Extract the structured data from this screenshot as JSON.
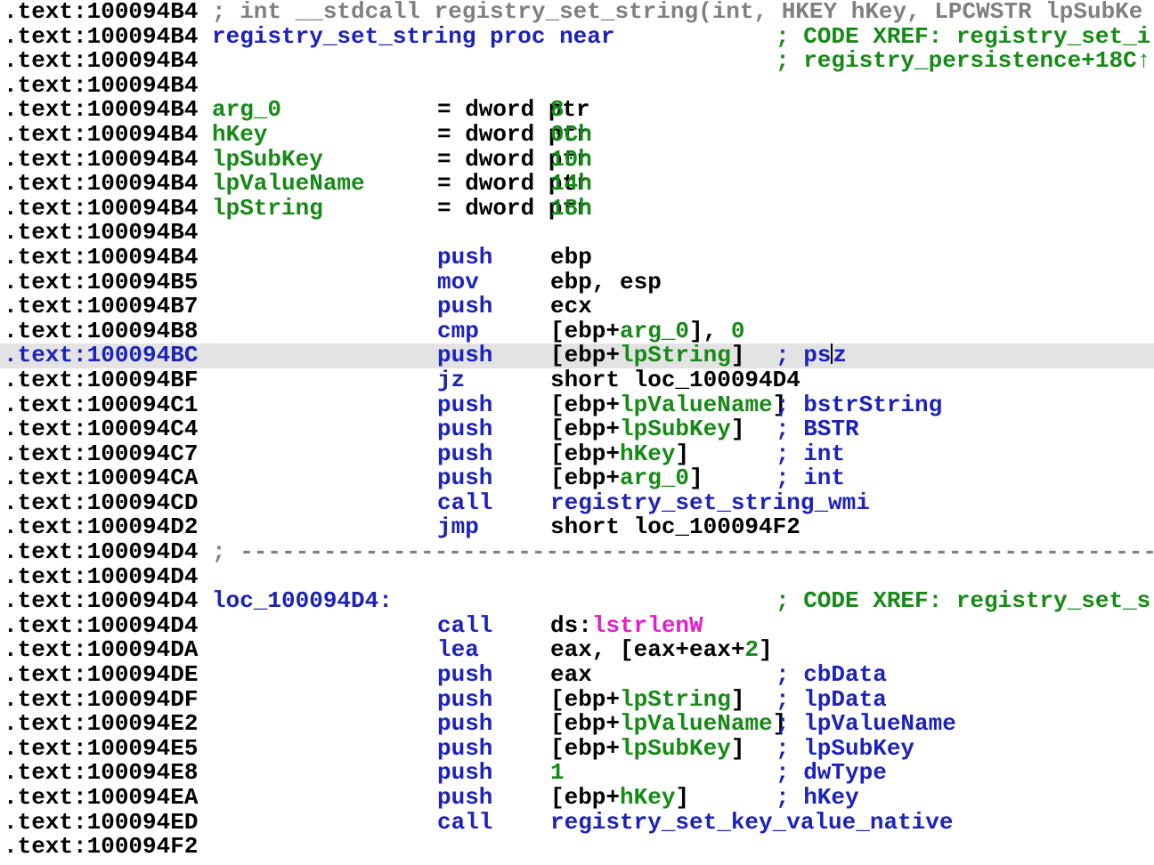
{
  "colors": {
    "address": "#000000",
    "selected_address": "#1d22b8",
    "mnemonic": "#1d22b8",
    "symbol": "#1d22b8",
    "variable": "#168a16",
    "xref_comment": "#168a16",
    "operand_comment": "#1d22b8",
    "import_name": "#e21ecf",
    "prototype_comment": "#808080",
    "selected_line_background": "#e3e3e3",
    "background": "#ffffff"
  },
  "lines": [
    {
      "addr": ".text:100094B4",
      "header": "; int __stdcall registry_set_string(int, HKEY hKey, LPCWSTR lpSubKe"
    },
    {
      "addr": ".text:100094B4",
      "label": "registry_set_string proc near",
      "comment": "; CODE XREF: registry_set_i"
    },
    {
      "addr": ".text:100094B4",
      "comment": "; registry_persistence+18C↑"
    },
    {
      "addr": ".text:100094B4"
    },
    {
      "addr": ".text:100094B4",
      "var": "arg_0",
      "eq": "= dword ptr",
      "val": "8"
    },
    {
      "addr": ".text:100094B4",
      "var": "hKey",
      "eq": "= dword ptr",
      "val": "0Ch"
    },
    {
      "addr": ".text:100094B4",
      "var": "lpSubKey",
      "eq": "= dword ptr",
      "val": "10h"
    },
    {
      "addr": ".text:100094B4",
      "var": "lpValueName",
      "eq": "= dword ptr",
      "val": "14h"
    },
    {
      "addr": ".text:100094B4",
      "var": "lpString",
      "eq": "= dword ptr",
      "val": "18h"
    },
    {
      "addr": ".text:100094B4"
    },
    {
      "addr": ".text:100094B4",
      "mn": "push",
      "op": [
        "ebp"
      ]
    },
    {
      "addr": ".text:100094B5",
      "mn": "mov",
      "op": [
        "ebp, esp"
      ]
    },
    {
      "addr": ".text:100094B7",
      "mn": "push",
      "op": [
        "ecx"
      ]
    },
    {
      "addr": ".text:100094B8",
      "mn": "cmp",
      "op": [
        "[ebp+",
        {
          "g": "arg_0"
        },
        "], ",
        {
          "g": "0"
        }
      ]
    },
    {
      "addr": ".text:100094BC",
      "mn": "push",
      "op": [
        "[ebp+",
        {
          "g": "lpString"
        },
        "]"
      ],
      "comment": "; ps",
      "comment_after_cursor": "z",
      "selected": true
    },
    {
      "addr": ".text:100094BF",
      "mn": "jz",
      "op": [
        "short loc_100094D4"
      ]
    },
    {
      "addr": ".text:100094C1",
      "mn": "push",
      "op": [
        "[ebp+",
        {
          "g": "lpValueName"
        },
        "]"
      ],
      "comment": "; bstrString"
    },
    {
      "addr": ".text:100094C4",
      "mn": "push",
      "op": [
        "[ebp+",
        {
          "g": "lpSubKey"
        },
        "]"
      ],
      "comment": "; BSTR"
    },
    {
      "addr": ".text:100094C7",
      "mn": "push",
      "op": [
        "[ebp+",
        {
          "g": "hKey"
        },
        "]"
      ],
      "comment": "; int"
    },
    {
      "addr": ".text:100094CA",
      "mn": "push",
      "op": [
        "[ebp+",
        {
          "g": "arg_0"
        },
        "]"
      ],
      "comment": "; int"
    },
    {
      "addr": ".text:100094CD",
      "mn": "call",
      "op": [
        {
          "b": "registry_set_string_wmi"
        }
      ]
    },
    {
      "addr": ".text:100094D2",
      "mn": "jmp",
      "op": [
        "short loc_100094F2"
      ]
    },
    {
      "addr": ".text:100094D4",
      "separator": "; -----------------------------------------------------------------------------------------------------"
    },
    {
      "addr": ".text:100094D4"
    },
    {
      "addr": ".text:100094D4",
      "label": "loc_100094D4:",
      "comment": "; CODE XREF: registry_set_s"
    },
    {
      "addr": ".text:100094D4",
      "mn": "call",
      "op": [
        "ds:",
        {
          "p": "lstrlenW"
        }
      ]
    },
    {
      "addr": ".text:100094DA",
      "mn": "lea",
      "op": [
        "eax, [eax+eax+",
        {
          "g": "2"
        },
        "]"
      ]
    },
    {
      "addr": ".text:100094DE",
      "mn": "push",
      "op": [
        "eax"
      ],
      "comment": "; cbData"
    },
    {
      "addr": ".text:100094DF",
      "mn": "push",
      "op": [
        "[ebp+",
        {
          "g": "lpString"
        },
        "]"
      ],
      "comment": "; lpData"
    },
    {
      "addr": ".text:100094E2",
      "mn": "push",
      "op": [
        "[ebp+",
        {
          "g": "lpValueName"
        },
        "]"
      ],
      "comment": "; lpValueName"
    },
    {
      "addr": ".text:100094E5",
      "mn": "push",
      "op": [
        "[ebp+",
        {
          "g": "lpSubKey"
        },
        "]"
      ],
      "comment": "; lpSubKey"
    },
    {
      "addr": ".text:100094E8",
      "mn": "push",
      "op": [
        {
          "g": "1"
        }
      ],
      "comment": "; dwType"
    },
    {
      "addr": ".text:100094EA",
      "mn": "push",
      "op": [
        "[ebp+",
        {
          "g": "hKey"
        },
        "]"
      ],
      "comment": "; hKey"
    },
    {
      "addr": ".text:100094ED",
      "mn": "call",
      "op": [
        {
          "b": "registry_set_key_value_native"
        }
      ]
    },
    {
      "addr": ".text:100094F2"
    }
  ]
}
